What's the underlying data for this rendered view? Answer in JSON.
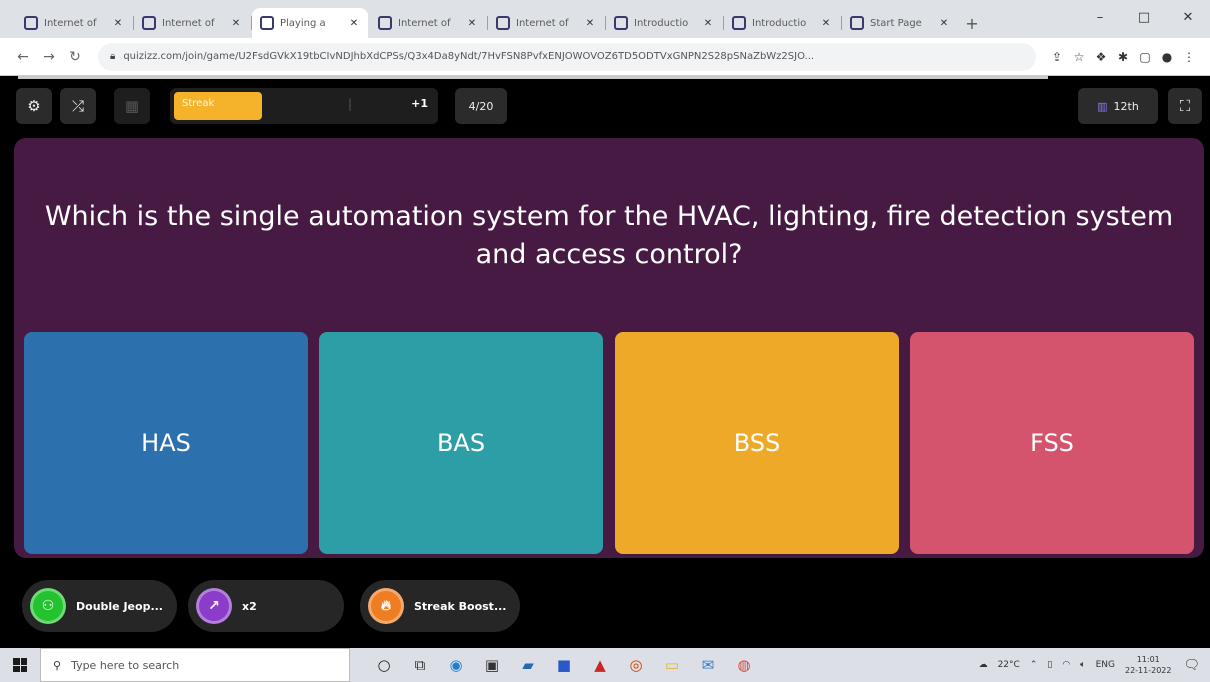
{
  "browser": {
    "tabs": [
      {
        "label": "Internet of",
        "active": false
      },
      {
        "label": "Internet of",
        "active": false
      },
      {
        "label": "Playing a",
        "active": true
      },
      {
        "label": "Internet of",
        "active": false
      },
      {
        "label": "Internet of",
        "active": false
      },
      {
        "label": "Introductio",
        "active": false
      },
      {
        "label": "Introductio",
        "active": false
      },
      {
        "label": "Start Page",
        "active": false
      }
    ],
    "new_tab": "+",
    "url": "quizizz.com/join/game/U2FsdGVkX19tbCIvNDJhbXdCPSs/Q3x4Da8yNdt/7HvFSN8PvfxENJOWOVOZ6TD5ODTVxGNPN2S28pSNaZbWz2SJO...",
    "window_controls": [
      "–",
      "□",
      "✕"
    ]
  },
  "toolbar": {
    "streak_label": "Streak",
    "streak_fill": 0.34,
    "streak_points": "+1",
    "question_counter": "4/20",
    "rank": "12th"
  },
  "question": {
    "text": "Which is the single automation system for the HVAC, lighting, fire detection system and access control?"
  },
  "options": [
    {
      "label": "HAS",
      "color": "#2d70ae"
    },
    {
      "label": "BAS",
      "color": "#2d9da6"
    },
    {
      "label": "BSS",
      "color": "#efa929"
    },
    {
      "label": "FSS",
      "color": "#d5546d"
    }
  ],
  "powerups": [
    {
      "label": "Double Jeop...",
      "color": "#22c32e"
    },
    {
      "label": "x2",
      "color": "#8b3cc8"
    },
    {
      "label": "Streak Boost...",
      "color": "#ef7d22"
    }
  ],
  "taskbar": {
    "search_placeholder": "Type here to search",
    "weather": "22°C",
    "language": "ENG",
    "time": "11:01",
    "date": "22-11-2022"
  }
}
